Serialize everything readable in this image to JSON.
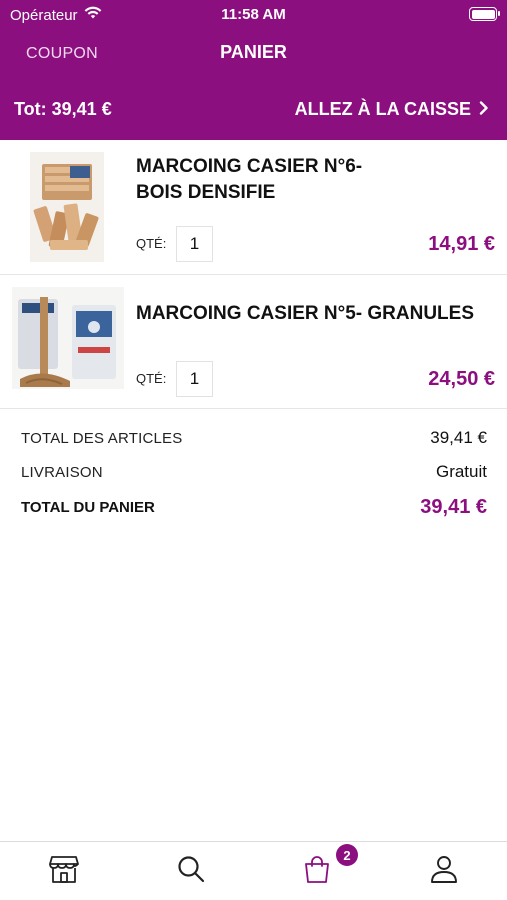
{
  "status_bar": {
    "carrier": "Opérateur",
    "time": "11:58 AM"
  },
  "header": {
    "coupon_label": "COUPON",
    "title": "PANIER",
    "total_label": "Tot: 39,41 €",
    "checkout_label": "ALLEZ À LA CAISSE"
  },
  "cart": {
    "items": [
      {
        "name_line1": "MARCOING CASIER N°6-",
        "name_line2": "BOIS DENSIFIE",
        "qty_label": "QTÉ:",
        "qty": "1",
        "price": "14,91 €"
      },
      {
        "name_line1": "MARCOING CASIER N°5- GRANULES",
        "qty_label": "QTÉ:",
        "qty": "1",
        "price": "24,50 €"
      }
    ]
  },
  "summary": {
    "articles_label": "TOTAL DES ARTICLES",
    "articles_value": "39,41 €",
    "delivery_label": "LIVRAISON",
    "delivery_value": "Gratuit",
    "total_label": "TOTAL DU PANIER",
    "total_value": "39,41 €"
  },
  "tabbar": {
    "tabs": [
      {
        "icon": "store-icon"
      },
      {
        "icon": "search-icon"
      },
      {
        "icon": "shopping-bag-icon",
        "active": true
      },
      {
        "icon": "user-icon"
      }
    ],
    "cart_badge": "2"
  },
  "colors": {
    "accent": "#8c0f7f",
    "divider": "#e6e6e6"
  }
}
